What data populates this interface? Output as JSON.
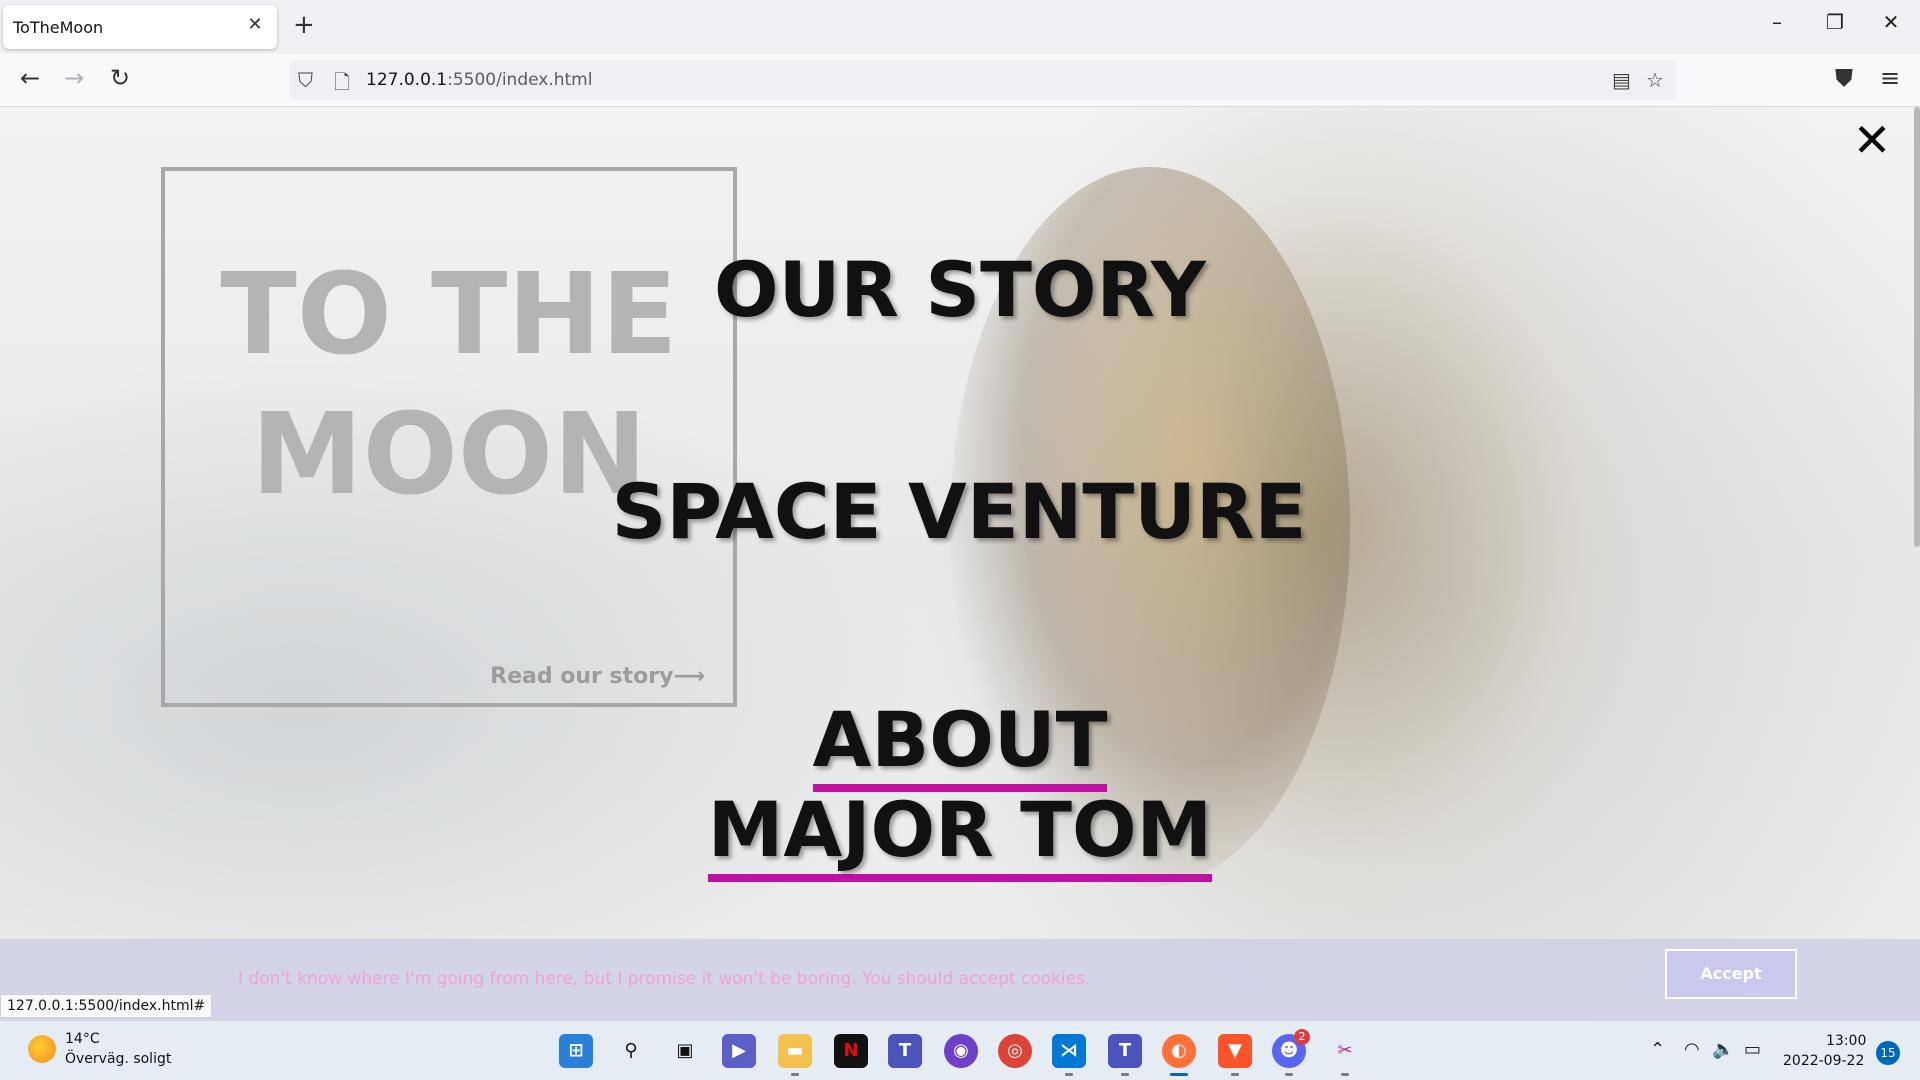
{
  "browser": {
    "tab_title": "ToTheMoon",
    "tab_close": "✕",
    "new_tab": "+",
    "url_host": "127.0.0.1",
    "url_rest": ":5500/index.html",
    "status_url": "127.0.0.1:5500/index.html#",
    "window_controls": [
      "–",
      "❐",
      "✕"
    ]
  },
  "page": {
    "card_title_line1": "TO THE",
    "card_title_line2": "MOON",
    "card_link": "Read our story⟶",
    "close_symbol": "✕",
    "menu": {
      "our_story": "OUR STORY",
      "space_venture": "SPACE VENTURE",
      "about_line1": "ABOUT",
      "about_line2": "MAJOR TOM"
    },
    "cookie_text": "I don't know where I'm going from here, but I promise it won't be boring. You should accept cookies.",
    "accept_label": "Accept",
    "accent_color": "#c012a2"
  },
  "taskbar": {
    "temperature": "14°C",
    "weather": "Överväg. soligt",
    "time": "13:00",
    "date": "2022-09-22",
    "notifications": "15",
    "discord_badge": "2"
  }
}
